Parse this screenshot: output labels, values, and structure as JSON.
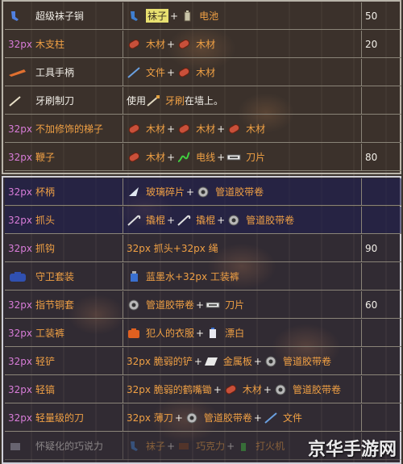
{
  "watermark": "京华手游网",
  "table1": [
    {
      "name_prefix": "",
      "name": "超级袜子锏",
      "name_color": "white",
      "name_icon": "sock-weapon-icon",
      "recipe": [
        {
          "icon": "sock-icon",
          "text": "袜子",
          "highlight": true
        },
        {
          "plus": true
        },
        {
          "icon": "battery-icon",
          "text": "电池"
        }
      ],
      "num": "50"
    },
    {
      "name_prefix": "32px",
      "name": "木支柱",
      "name_color": "orange",
      "name_icon": "",
      "recipe": [
        {
          "icon": "wood-icon",
          "text": "木材"
        },
        {
          "plus": true
        },
        {
          "icon": "wood-icon",
          "text": "木材"
        }
      ],
      "num": "20"
    },
    {
      "name_prefix": "",
      "name": "工具手柄",
      "name_color": "white",
      "name_icon": "tool-handle-icon",
      "recipe": [
        {
          "icon": "file-tool-icon",
          "text": "文件"
        },
        {
          "plus": true
        },
        {
          "icon": "wood-icon",
          "text": "木材"
        }
      ],
      "num": ""
    },
    {
      "name_prefix": "",
      "name": "牙刷制刀",
      "name_color": "white",
      "name_icon": "toothbrush-knife-icon",
      "recipe": [
        {
          "icon": "",
          "text": "使用"
        },
        {
          "icon": "toothbrush-icon",
          "text": "牙刷"
        },
        {
          "icon": "",
          "text": "在墙上。"
        }
      ],
      "num": ""
    },
    {
      "name_prefix": "32px",
      "name": "不加修饰的梯子",
      "name_color": "orange",
      "name_icon": "",
      "recipe": [
        {
          "icon": "wood-icon",
          "text": "木材"
        },
        {
          "plus": true
        },
        {
          "icon": "wood-icon",
          "text": "木材"
        },
        {
          "plus": true
        },
        {
          "icon": "wood-icon",
          "text": "木材"
        }
      ],
      "num": ""
    },
    {
      "name_prefix": "32px",
      "name": "鞭子",
      "name_color": "orange",
      "name_icon": "",
      "recipe": [
        {
          "icon": "wood-icon",
          "text": "木材"
        },
        {
          "plus": true
        },
        {
          "icon": "wire-icon",
          "text": "电线"
        },
        {
          "plus": true
        },
        {
          "icon": "blade-icon",
          "text": "刀片"
        }
      ],
      "num": "80"
    }
  ],
  "table2": [
    {
      "name_prefix": "32px",
      "name": "杯柄",
      "name_color": "orange",
      "name_icon": "",
      "hl": true,
      "recipe": [
        {
          "icon": "glass-shard-icon",
          "text": "玻璃碎片"
        },
        {
          "plus": true
        },
        {
          "icon": "duct-tape-icon",
          "text": "管道胶带卷"
        }
      ],
      "num": ""
    },
    {
      "name_prefix": "32px",
      "name": "抓头",
      "name_color": "orange",
      "name_icon": "",
      "hl": true,
      "recipe": [
        {
          "icon": "crowbar-icon",
          "text": "撬棍"
        },
        {
          "plus": true
        },
        {
          "icon": "crowbar-icon",
          "text": "撬棍"
        },
        {
          "plus": true
        },
        {
          "icon": "duct-tape-icon",
          "text": "管道胶带卷"
        }
      ],
      "num": ""
    },
    {
      "name_prefix": "32px",
      "name": "抓钩",
      "name_color": "orange",
      "name_icon": "",
      "hl": false,
      "recipe": [
        {
          "icon": "",
          "text": "32px 抓头+32px 绳"
        }
      ],
      "num": "90"
    },
    {
      "name_prefix": "",
      "name": "守卫套装",
      "name_color": "orange",
      "name_icon": "guard-outfit-icon",
      "hl": false,
      "recipe": [
        {
          "icon": "ink-bottle-icon",
          "text": "蓝墨水+32px 工装裤"
        }
      ],
      "num": ""
    },
    {
      "name_prefix": "32px",
      "name": "指节铜套",
      "name_color": "orange",
      "name_icon": "",
      "hl": false,
      "recipe": [
        {
          "icon": "duct-tape-icon",
          "text": "管道胶带卷"
        },
        {
          "plus": true
        },
        {
          "icon": "blade-icon",
          "text": "刀片"
        }
      ],
      "num": "60"
    },
    {
      "name_prefix": "32px",
      "name": "工装裤",
      "name_color": "orange",
      "name_icon": "",
      "hl": false,
      "recipe": [
        {
          "icon": "inmate-outfit-icon",
          "text": "犯人的衣服"
        },
        {
          "plus": true
        },
        {
          "icon": "bleach-icon",
          "text": "漂白"
        }
      ],
      "num": ""
    },
    {
      "name_prefix": "32px",
      "name": "轻铲",
      "name_color": "orange",
      "name_icon": "",
      "hl": false,
      "recipe": [
        {
          "icon": "",
          "text": "32px 脆弱的铲"
        },
        {
          "plus": true
        },
        {
          "icon": "metal-plate-icon",
          "text": "金属板"
        },
        {
          "plus": true
        },
        {
          "icon": "duct-tape-icon",
          "text": "管道胶带卷"
        }
      ],
      "num": ""
    },
    {
      "name_prefix": "32px",
      "name": "轻镐",
      "name_color": "orange",
      "name_icon": "",
      "hl": false,
      "recipe": [
        {
          "icon": "",
          "text": "32px 脆弱的鹤嘴锄"
        },
        {
          "plus": true
        },
        {
          "icon": "wood-icon",
          "text": "木材"
        },
        {
          "plus": true
        },
        {
          "icon": "duct-tape-icon",
          "text": "管道胶带卷"
        }
      ],
      "num": ""
    },
    {
      "name_prefix": "32px",
      "name": "轻量级的刀",
      "name_color": "orange",
      "name_icon": "",
      "hl": false,
      "recipe": [
        {
          "icon": "",
          "text": "32px 薄刀"
        },
        {
          "plus": true
        },
        {
          "icon": "duct-tape-icon",
          "text": "管道胶带卷"
        },
        {
          "plus": true
        },
        {
          "icon": "file-tool-icon",
          "text": "文件"
        }
      ],
      "num": ""
    },
    {
      "name_prefix": "",
      "name": "怀疑化的巧说力",
      "name_color": "white",
      "name_icon": "faded-item-icon",
      "hl": false,
      "faded": true,
      "recipe": [
        {
          "icon": "sock-icon",
          "text": "袜子"
        },
        {
          "plus": true
        },
        {
          "icon": "chocolate-icon",
          "text": "巧克力"
        },
        {
          "plus": true
        },
        {
          "icon": "lighter-icon",
          "text": "打火机"
        }
      ],
      "num": ""
    }
  ]
}
